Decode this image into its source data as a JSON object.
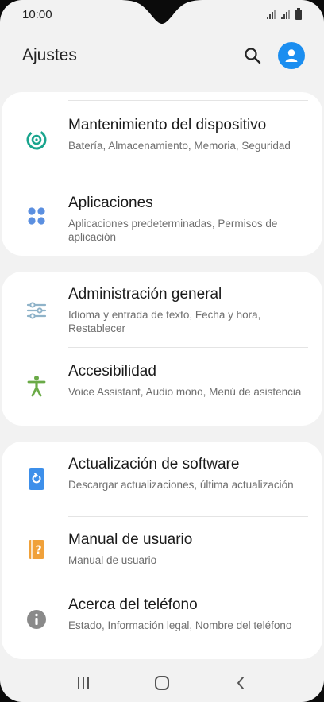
{
  "status_bar": {
    "time": "10:00"
  },
  "header": {
    "title": "Ajustes"
  },
  "icons": {
    "search": "search-icon",
    "profile": "profile-icon"
  },
  "colors": {
    "background": "#f2f2f2",
    "card": "#ffffff",
    "accent_blue": "#1b8ef0",
    "maintenance_teal": "#1aa58e",
    "apps_blue": "#5b8fe0",
    "general_mgmt": "#8fb3c9",
    "accessibility_green": "#6aaa47",
    "software_update_blue": "#3d8fea",
    "manual_orange": "#f0a13a",
    "about_gray": "#8a8a8a"
  },
  "sections": [
    {
      "items": [
        {
          "icon": "device-care-icon",
          "title": "Mantenimiento del dispositivo",
          "subtitle": "Batería, Almacenamiento, Memoria, Seguridad"
        },
        {
          "icon": "apps-icon",
          "title": "Aplicaciones",
          "subtitle": "Aplicaciones predeterminadas, Permisos de aplicación"
        }
      ]
    },
    {
      "items": [
        {
          "icon": "sliders-icon",
          "title": "Administración general",
          "subtitle": "Idioma y entrada de texto, Fecha y hora, Restablecer"
        },
        {
          "icon": "accessibility-icon",
          "title": "Accesibilidad",
          "subtitle": "Voice Assistant, Audio mono, Menú de asistencia"
        }
      ]
    },
    {
      "items": [
        {
          "icon": "software-update-icon",
          "title": "Actualización de software",
          "subtitle": "Descargar actualizaciones, última actualización"
        },
        {
          "icon": "user-manual-icon",
          "title": "Manual de usuario",
          "subtitle": "Manual de usuario"
        },
        {
          "icon": "info-icon",
          "title": "Acerca del teléfono",
          "subtitle": "Estado, Información legal, Nombre del teléfono"
        }
      ]
    }
  ],
  "navigation": {
    "recents": "recents-icon",
    "home": "home-icon",
    "back": "back-icon"
  }
}
